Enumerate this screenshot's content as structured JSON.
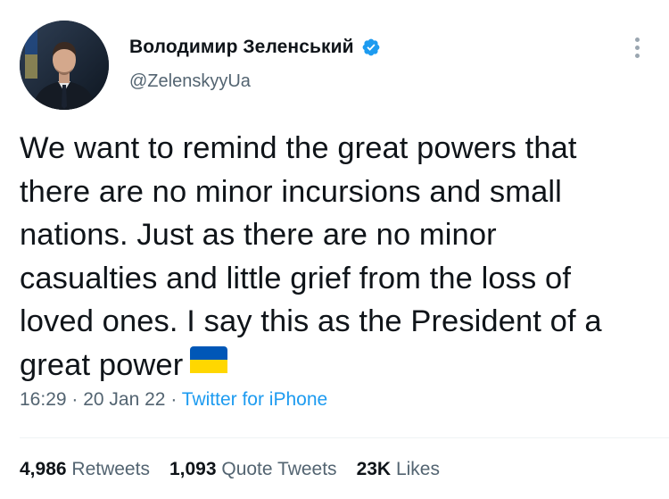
{
  "author": {
    "display_name": "Володимир Зеленський",
    "handle": "@ZelenskyyUa",
    "verified": true
  },
  "tweet": {
    "lines": [
      "We want to remind the great powers that",
      "there are no minor incursions and small",
      "nations. Just as there are no minor",
      "casualties and little grief from the loss of",
      "loved ones. I say this as the President of a",
      "great power"
    ],
    "emoji": "ukraine-flag-icon"
  },
  "meta": {
    "time": "16:29",
    "separator": " · ",
    "date": "20 Jan 22",
    "source": "Twitter for iPhone"
  },
  "stats": {
    "retweets_count": "4,986",
    "retweets_label": "Retweets",
    "quotes_count": "1,093",
    "quotes_label": "Quote Tweets",
    "likes_count": "23K",
    "likes_label": "Likes"
  },
  "colors": {
    "text": "#0f1419",
    "secondary": "#536471",
    "accent": "#1d9bf0",
    "flag_blue": "#0057b7",
    "flag_yellow": "#ffd700"
  }
}
